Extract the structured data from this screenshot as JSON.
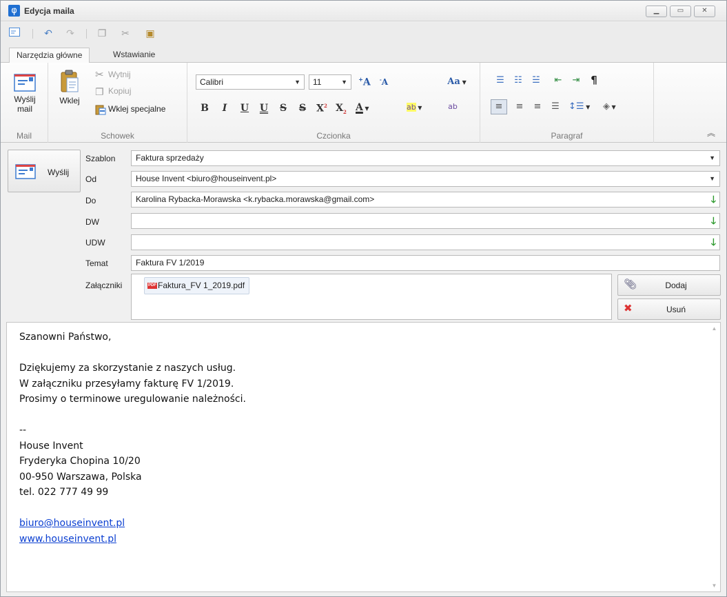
{
  "window": {
    "title": "Edycja maila",
    "app_icon": "phi-icon",
    "controls": [
      "minimize",
      "maximize",
      "close"
    ]
  },
  "quick_access": {
    "icons": [
      "send-mail-icon",
      "undo-icon",
      "redo-icon",
      "copy-icon",
      "cut-icon",
      "paste-icon"
    ]
  },
  "ribbon": {
    "tabs": [
      {
        "label": "Narzędzia główne",
        "active": true
      },
      {
        "label": "Wstawianie",
        "active": false
      }
    ],
    "groups": {
      "mail": {
        "label": "Mail",
        "send_label_1": "Wyślij",
        "send_label_2": "mail"
      },
      "clipboard": {
        "label": "Schowek",
        "paste": "Wklej",
        "cut": "Wytnij",
        "copy": "Kopiuj",
        "paste_special": "Wklej specjalne"
      },
      "font": {
        "label": "Czcionka",
        "family": "Calibri",
        "size": "11",
        "grow": "A",
        "shrink": "A",
        "change_case": "Aa",
        "bold": "B",
        "italic": "I",
        "underline": "U",
        "double_underline": "U",
        "strike": "S",
        "double_strike": "S",
        "superscript": "X",
        "subscript": "X",
        "font_color": "A"
      },
      "paragraph": {
        "label": "Paragraf",
        "pilcrow": "¶"
      }
    }
  },
  "header": {
    "send_button": "Wyślij",
    "labels": {
      "template": "Szablon",
      "from": "Od",
      "to": "Do",
      "cc": "DW",
      "bcc": "UDW",
      "subject": "Temat",
      "attachments": "Załączniki"
    },
    "values": {
      "template": "Faktura sprzedaży",
      "from": "House Invent <biuro@houseinvent.pl>",
      "to": "Karolina Rybacka-Morawska <k.rybacka.morawska@gmail.com>",
      "cc": "",
      "bcc": "",
      "subject": "Faktura FV 1/2019"
    },
    "attachment": {
      "name": "Faktura_FV 1_2019.pdf",
      "badge": "PDF"
    },
    "add_button": "Dodaj",
    "remove_button": "Usuń"
  },
  "body": {
    "lines": [
      "Szanowni Państwo,",
      "",
      "Dziękujemy za skorzystanie z naszych usług.",
      "W załączniku przesyłamy fakturę FV 1/2019.",
      "Prosimy o terminowe uregulowanie należności.",
      "",
      "--",
      "House Invent",
      "Fryderyka Chopina 10/20",
      "00-950 Warszawa, Polska",
      "tel. 022 777 49 99",
      ""
    ],
    "links": [
      "biuro@houseinvent.pl",
      "www.houseinvent.pl"
    ]
  },
  "colors": {
    "accent": "#1f6fd1",
    "green_arrow": "#2e9a2e",
    "link": "#0b3fd1",
    "pdf_red": "#dd3333"
  }
}
